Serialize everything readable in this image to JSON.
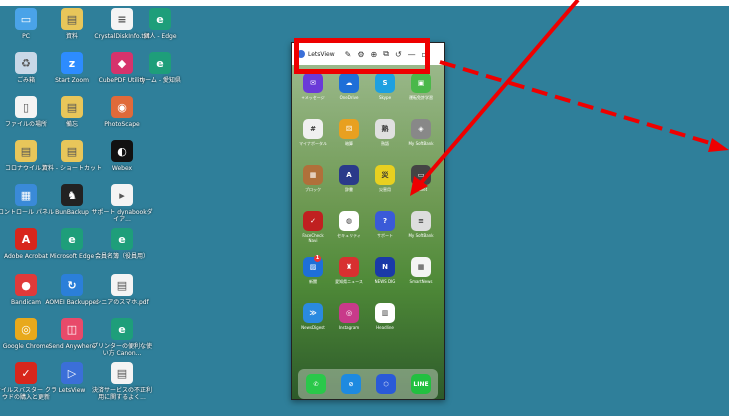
{
  "desktop_icons": [
    {
      "label": "PC",
      "icon": "pc-icon",
      "color": "#4aa3e8",
      "glyph": "▭"
    },
    {
      "label": "資料",
      "icon": "folder-icon",
      "color": "#e8c65a",
      "glyph": "▤"
    },
    {
      "label": "CrystalDiskInfo.txt",
      "icon": "text-file-icon",
      "color": "#f4f4f4",
      "glyph": "≡"
    },
    {
      "label": "個人 - Edge",
      "icon": "edge-icon",
      "color": "#1e9e7a",
      "glyph": "e"
    },
    {
      "label": "ごみ箱",
      "icon": "recycle-bin-icon",
      "color": "#c8d8e8",
      "glyph": "♻"
    },
    {
      "label": "Start Zoom",
      "icon": "zoom-icon",
      "color": "#2d8cff",
      "glyph": "z"
    },
    {
      "label": "CubePDF Utility",
      "icon": "cubepdf-icon",
      "color": "#d6336c",
      "glyph": "◆"
    },
    {
      "label": "ホーム - 愛知県",
      "icon": "edge-icon",
      "color": "#1e9e7a",
      "glyph": "e"
    },
    {
      "label": "ファイルの場所",
      "icon": "file-icon",
      "color": "#f4f4f4",
      "glyph": "▯"
    },
    {
      "label": "備忘",
      "icon": "folder-icon",
      "color": "#e8c65a",
      "glyph": "▤"
    },
    {
      "label": "PhotoScape",
      "icon": "photoscape-icon",
      "color": "#e06a3a",
      "glyph": "◉"
    },
    {
      "label": "コロナウイルス",
      "icon": "folder-icon",
      "color": "#e8c65a",
      "glyph": "▤"
    },
    {
      "label": "資料 - ショートカット",
      "icon": "folder-shortcut-icon",
      "color": "#e8c65a",
      "glyph": "▤"
    },
    {
      "label": "Webex",
      "icon": "webex-icon",
      "color": "#111111",
      "glyph": "◐"
    },
    {
      "label": "コントロール パネル",
      "icon": "control-panel-icon",
      "color": "#3a8ad8",
      "glyph": "▦"
    },
    {
      "label": "BunBackup",
      "icon": "bunbackup-icon",
      "color": "#222222",
      "glyph": "♞"
    },
    {
      "label": "サポート dynabookダイア...",
      "icon": "dynabook-icon",
      "color": "#f4f4f4",
      "glyph": "▸"
    },
    {
      "label": "Adobe Acrobat",
      "icon": "acrobat-icon",
      "color": "#d8261c",
      "glyph": "A"
    },
    {
      "label": "Microsoft Edge",
      "icon": "edge-icon",
      "color": "#1e9e7a",
      "glyph": "e"
    },
    {
      "label": "会員名簿（役員用）",
      "icon": "edge-icon",
      "color": "#1e9e7a",
      "glyph": "e"
    },
    {
      "label": "Bandicam",
      "icon": "bandicam-icon",
      "color": "#e03a3a",
      "glyph": "●"
    },
    {
      "label": "AOMEI Backupper",
      "icon": "aomei-icon",
      "color": "#2b7fd9",
      "glyph": "↻"
    },
    {
      "label": "シニアのスマホ.pdf",
      "icon": "pdf-icon",
      "color": "#f4f4f4",
      "glyph": "▤"
    },
    {
      "label": "Google Chrome",
      "icon": "chrome-icon",
      "color": "#e8a91c",
      "glyph": "◎"
    },
    {
      "label": "Send Anywhere",
      "icon": "send-anywhere-icon",
      "color": "#e84a6a",
      "glyph": "◫"
    },
    {
      "label": "プリンターの便利な使い方 Canon...",
      "icon": "edge-icon",
      "color": "#1e9e7a",
      "glyph": "e"
    },
    {
      "label": "ウイルスバスター クラウドの購入と更新",
      "icon": "virusbuster-icon",
      "color": "#d8261c",
      "glyph": "✓"
    },
    {
      "label": "LetsView",
      "icon": "letsview-icon",
      "color": "#3b6fd8",
      "glyph": "▷"
    },
    {
      "label": "決済サービスの不正利用に関するよく...",
      "icon": "pdf-icon",
      "color": "#f4f4f4",
      "glyph": "▤"
    }
  ],
  "window": {
    "app_name": "LetsView",
    "toolbar": [
      "✎",
      "⚙",
      "⊕",
      "⧉",
      "↺",
      "—",
      "▫"
    ]
  },
  "phone_apps": [
    {
      "label": "+メッセージ",
      "color": "#6a3ad8",
      "glyph": "✉"
    },
    {
      "label": "OneDrive",
      "color": "#1e6fd8",
      "glyph": "☁"
    },
    {
      "label": "Skype",
      "color": "#1ea0e0",
      "glyph": "S"
    },
    {
      "label": "運転免許学習",
      "color": "#4ab84a",
      "glyph": "▣"
    },
    {
      "label": "マイナポータル",
      "color": "#f0f0f0",
      "glyph": "#"
    },
    {
      "label": "暗算",
      "color": "#e8a020",
      "glyph": "⚄"
    },
    {
      "label": "熟語",
      "color": "#e0e0e0",
      "glyph": "熟"
    },
    {
      "label": "My SoftBank",
      "color": "#888888",
      "glyph": "◈"
    },
    {
      "label": "ブロック",
      "color": "#b0703a",
      "glyph": "▦"
    },
    {
      "label": "辞書",
      "color": "#2a3a8a",
      "glyph": "A"
    },
    {
      "label": "災害用",
      "color": "#e8d020",
      "glyph": "災"
    },
    {
      "label": "Wallet",
      "color": "#444444",
      "glyph": "▭"
    },
    {
      "label": "FaceCheck Navi",
      "color": "#c02020",
      "glyph": "✓"
    },
    {
      "label": "セキュリティ",
      "color": "#ffffff",
      "glyph": "◍"
    },
    {
      "label": "サポート",
      "color": "#3a5ad8",
      "glyph": "?"
    },
    {
      "label": "My SoftBank",
      "color": "#dddddd",
      "glyph": "≡"
    },
    {
      "label": "新聞",
      "color": "#1e6fd8",
      "glyph": "▨"
    },
    {
      "label": "愛知県ニュース",
      "color": "#d83030",
      "glyph": "♜"
    },
    {
      "label": "NEWS DIG",
      "color": "#1a3aa8",
      "glyph": "N"
    },
    {
      "label": "SmartNews",
      "color": "#f4f4f4",
      "glyph": "▦"
    },
    {
      "label": "NewsDigest",
      "color": "#2a8ae0",
      "glyph": "≫"
    },
    {
      "label": "Instagram",
      "color": "#c83a8a",
      "glyph": "◎"
    },
    {
      "label": "Headline",
      "color": "#ffffff",
      "glyph": "▥"
    }
  ],
  "dock_apps": [
    {
      "label": "Phone",
      "color": "#2ac84a",
      "glyph": "✆"
    },
    {
      "label": "Safari",
      "color": "#1e8ae0",
      "glyph": "⊘"
    },
    {
      "label": "Box",
      "color": "#2a5ad8",
      "glyph": "⬡"
    },
    {
      "label": "LINE",
      "color": "#22c040",
      "glyph": "LINE"
    }
  ],
  "badge_count": "1"
}
